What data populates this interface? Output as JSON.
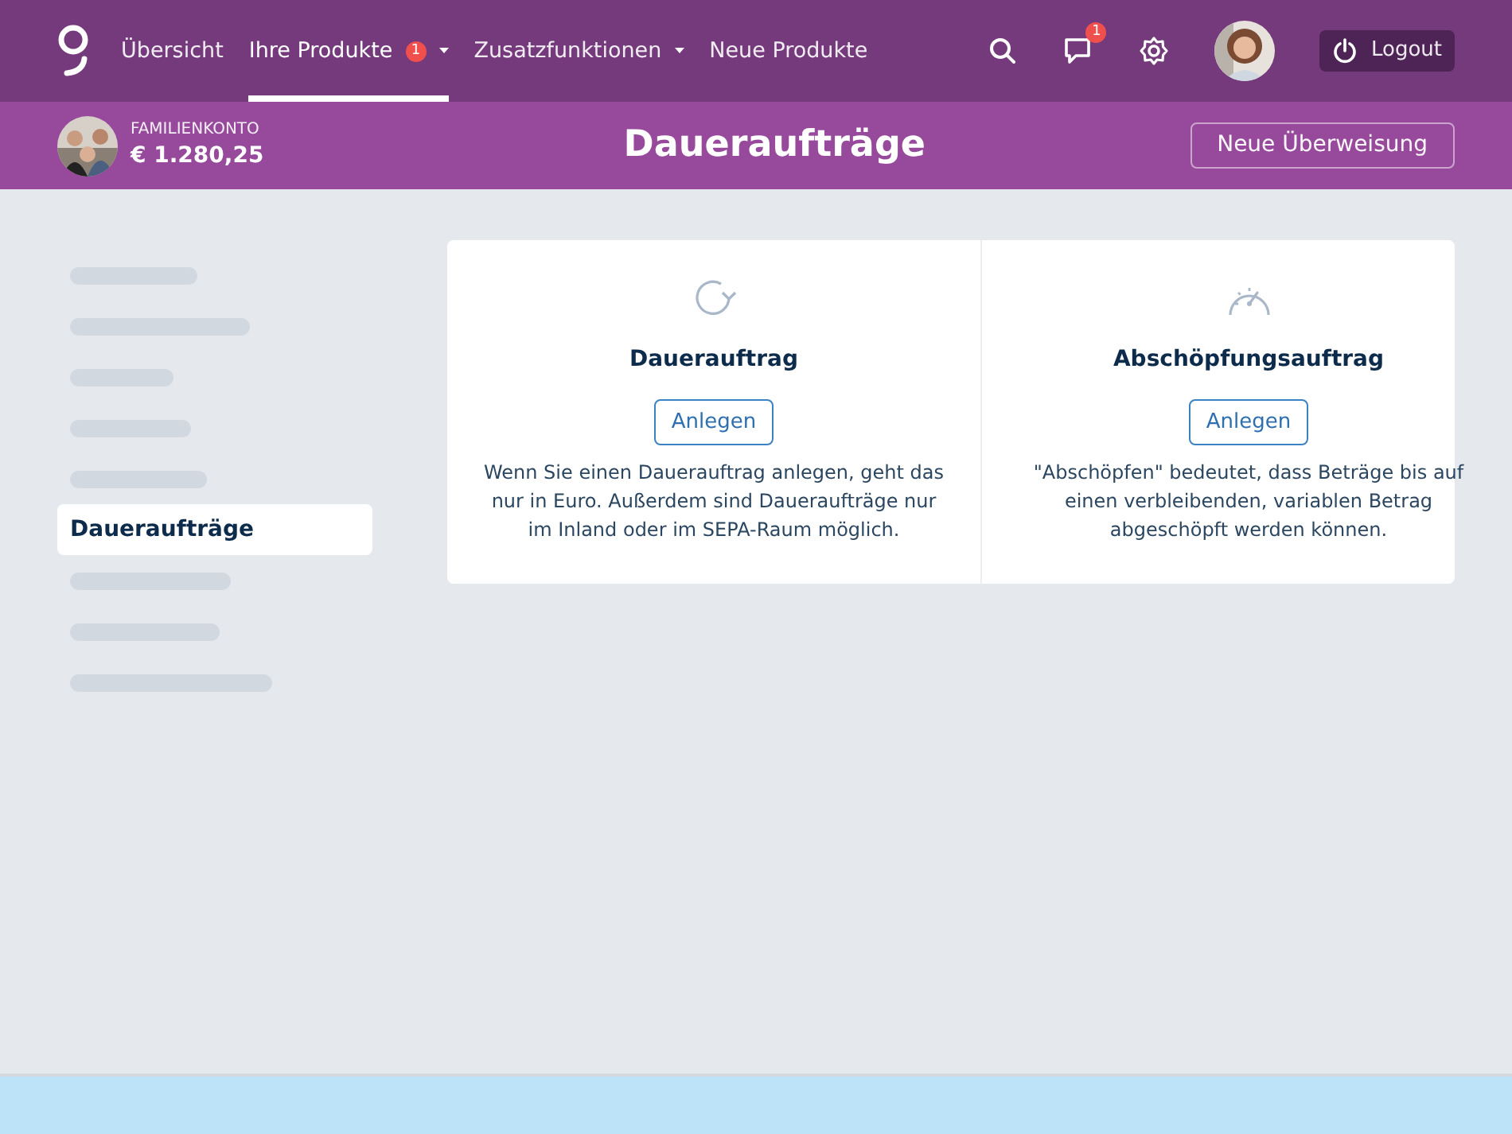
{
  "nav": {
    "items": [
      {
        "label": "Übersicht",
        "selected": false,
        "dropdown": false
      },
      {
        "label": "Ihre Produkte",
        "selected": true,
        "badge": "1",
        "dropdown": true
      },
      {
        "label": "Zusatzfunktionen",
        "selected": false,
        "dropdown": true
      },
      {
        "label": "Neue Produkte",
        "selected": false,
        "dropdown": false
      }
    ],
    "messages_badge": "1",
    "logout": "Logout"
  },
  "account": {
    "type": "FAMILIENKONTO",
    "balance": "€ 1.280,25"
  },
  "page_title": "Daueraufträge",
  "primary_action": "Neue Überweisung",
  "sidebar": {
    "items": [
      {
        "kind": "placeholder"
      },
      {
        "kind": "placeholder"
      },
      {
        "kind": "placeholder"
      },
      {
        "kind": "placeholder"
      },
      {
        "kind": "placeholder"
      },
      {
        "kind": "link",
        "label": "Daueraufträge",
        "selected": true
      },
      {
        "kind": "placeholder"
      },
      {
        "kind": "placeholder"
      },
      {
        "kind": "placeholder"
      }
    ]
  },
  "cards": [
    {
      "kind": "recurring",
      "title": "Dauerauftrag",
      "button": "Anlegen",
      "text": "Wenn Sie einen Dauerauftrag anlegen, geht das nur in Euro. Außerdem sind Daueraufträge nur im Inland oder im SEPA-Raum möglich."
    },
    {
      "kind": "gauge",
      "title": "Abschöpfungsauftrag",
      "button": "Anlegen",
      "text": "\"Abschöpfen\" bedeutet, dass Beträge bis auf einen verbleibenden, variablen Betrag abgeschöpft werden können."
    }
  ]
}
